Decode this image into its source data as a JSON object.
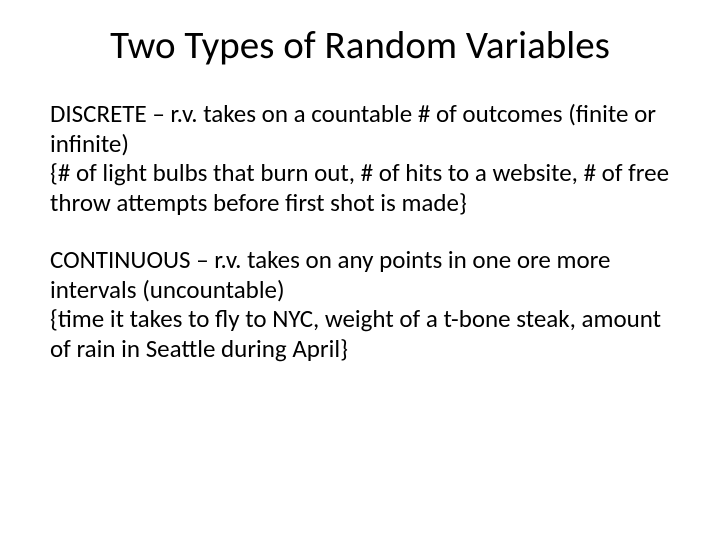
{
  "slide": {
    "title": "Two Types of Random Variables",
    "discrete": {
      "def": "DISCRETE – r.v. takes on a countable # of outcomes (finite or infinite)",
      "examples": "{# of light bulbs that burn out, # of hits to a website, # of free throw attempts before first shot is made}"
    },
    "continuous": {
      "def": "CONTINUOUS – r.v. takes on any points in one ore more intervals (uncountable)",
      "examples": "{time it takes to fly to NYC, weight of a t-bone steak, amount of rain in Seattle during April}"
    }
  }
}
